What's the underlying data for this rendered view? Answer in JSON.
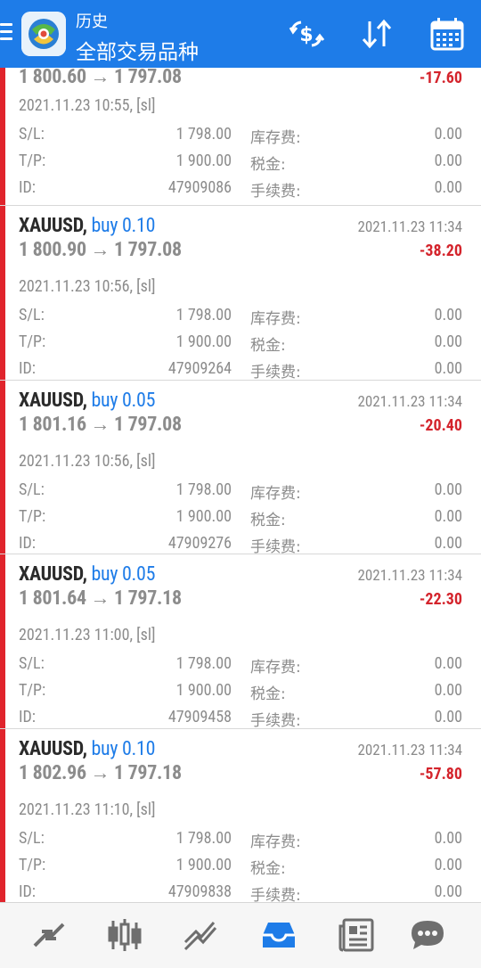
{
  "header": {
    "title_top": "历史",
    "title_main": "全部交易品种",
    "icons": [
      "menu-icon",
      "app-logo",
      "currency-exchange-icon",
      "sort-icon",
      "calendar-icon"
    ],
    "accent_color": "#1e7ce8"
  },
  "trades": [
    {
      "symbol": "",
      "side": "",
      "close_time": "",
      "prices": "1 800.60 → 1 797.08",
      "profit": "-17.60",
      "open_time": "2021.11.23 10:55, [sl]",
      "sl_label": "S/L:",
      "sl": "1 798.00",
      "tp_label": "T/P:",
      "tp": "1 900.00",
      "id_label": "ID:",
      "id": "47909086",
      "swap_label": "库存费:",
      "swap": "0.00",
      "tax_label": "税金:",
      "tax": "0.00",
      "fee_label": "手续费:",
      "fee": "0.00"
    },
    {
      "symbol": "XAUUSD,",
      "side": "buy 0.10",
      "close_time": "2021.11.23 11:34",
      "prices": "1 800.90 → 1 797.08",
      "profit": "-38.20",
      "open_time": "2021.11.23 10:56, [sl]",
      "sl_label": "S/L:",
      "sl": "1 798.00",
      "tp_label": "T/P:",
      "tp": "1 900.00",
      "id_label": "ID:",
      "id": "47909264",
      "swap_label": "库存费:",
      "swap": "0.00",
      "tax_label": "税金:",
      "tax": "0.00",
      "fee_label": "手续费:",
      "fee": "0.00"
    },
    {
      "symbol": "XAUUSD,",
      "side": "buy 0.05",
      "close_time": "2021.11.23 11:34",
      "prices": "1 801.16 → 1 797.08",
      "profit": "-20.40",
      "open_time": "2021.11.23 10:56, [sl]",
      "sl_label": "S/L:",
      "sl": "1 798.00",
      "tp_label": "T/P:",
      "tp": "1 900.00",
      "id_label": "ID:",
      "id": "47909276",
      "swap_label": "库存费:",
      "swap": "0.00",
      "tax_label": "税金:",
      "tax": "0.00",
      "fee_label": "手续费:",
      "fee": "0.00"
    },
    {
      "symbol": "XAUUSD,",
      "side": "buy 0.05",
      "close_time": "2021.11.23 11:34",
      "prices": "1 801.64 → 1 797.18",
      "profit": "-22.30",
      "open_time": "2021.11.23 11:00, [sl]",
      "sl_label": "S/L:",
      "sl": "1 798.00",
      "tp_label": "T/P:",
      "tp": "1 900.00",
      "id_label": "ID:",
      "id": "47909458",
      "swap_label": "库存费:",
      "swap": "0.00",
      "tax_label": "税金:",
      "tax": "0.00",
      "fee_label": "手续费:",
      "fee": "0.00"
    },
    {
      "symbol": "XAUUSD,",
      "side": "buy 0.10",
      "close_time": "2021.11.23 11:34",
      "prices": "1 802.96 → 1 797.18",
      "profit": "-57.80",
      "open_time": "2021.11.23 11:10, [sl]",
      "sl_label": "S/L:",
      "sl": "1 798.00",
      "tp_label": "T/P:",
      "tp": "1 900.00",
      "id_label": "ID:",
      "id": "47909838",
      "swap_label": "库存费:",
      "swap": "0.00",
      "tax_label": "税金:",
      "tax": "0.00",
      "fee_label": "手续费:",
      "fee": "0.00"
    }
  ],
  "colors": {
    "loss": "#d4242c",
    "side": "#1e7ce8",
    "card_bar": "#e0242c"
  },
  "bottom_nav": {
    "items": [
      "quotes-icon",
      "chart-icon",
      "trade-icon",
      "history-icon",
      "news-icon",
      "chat-icon"
    ],
    "active": "history-icon"
  }
}
